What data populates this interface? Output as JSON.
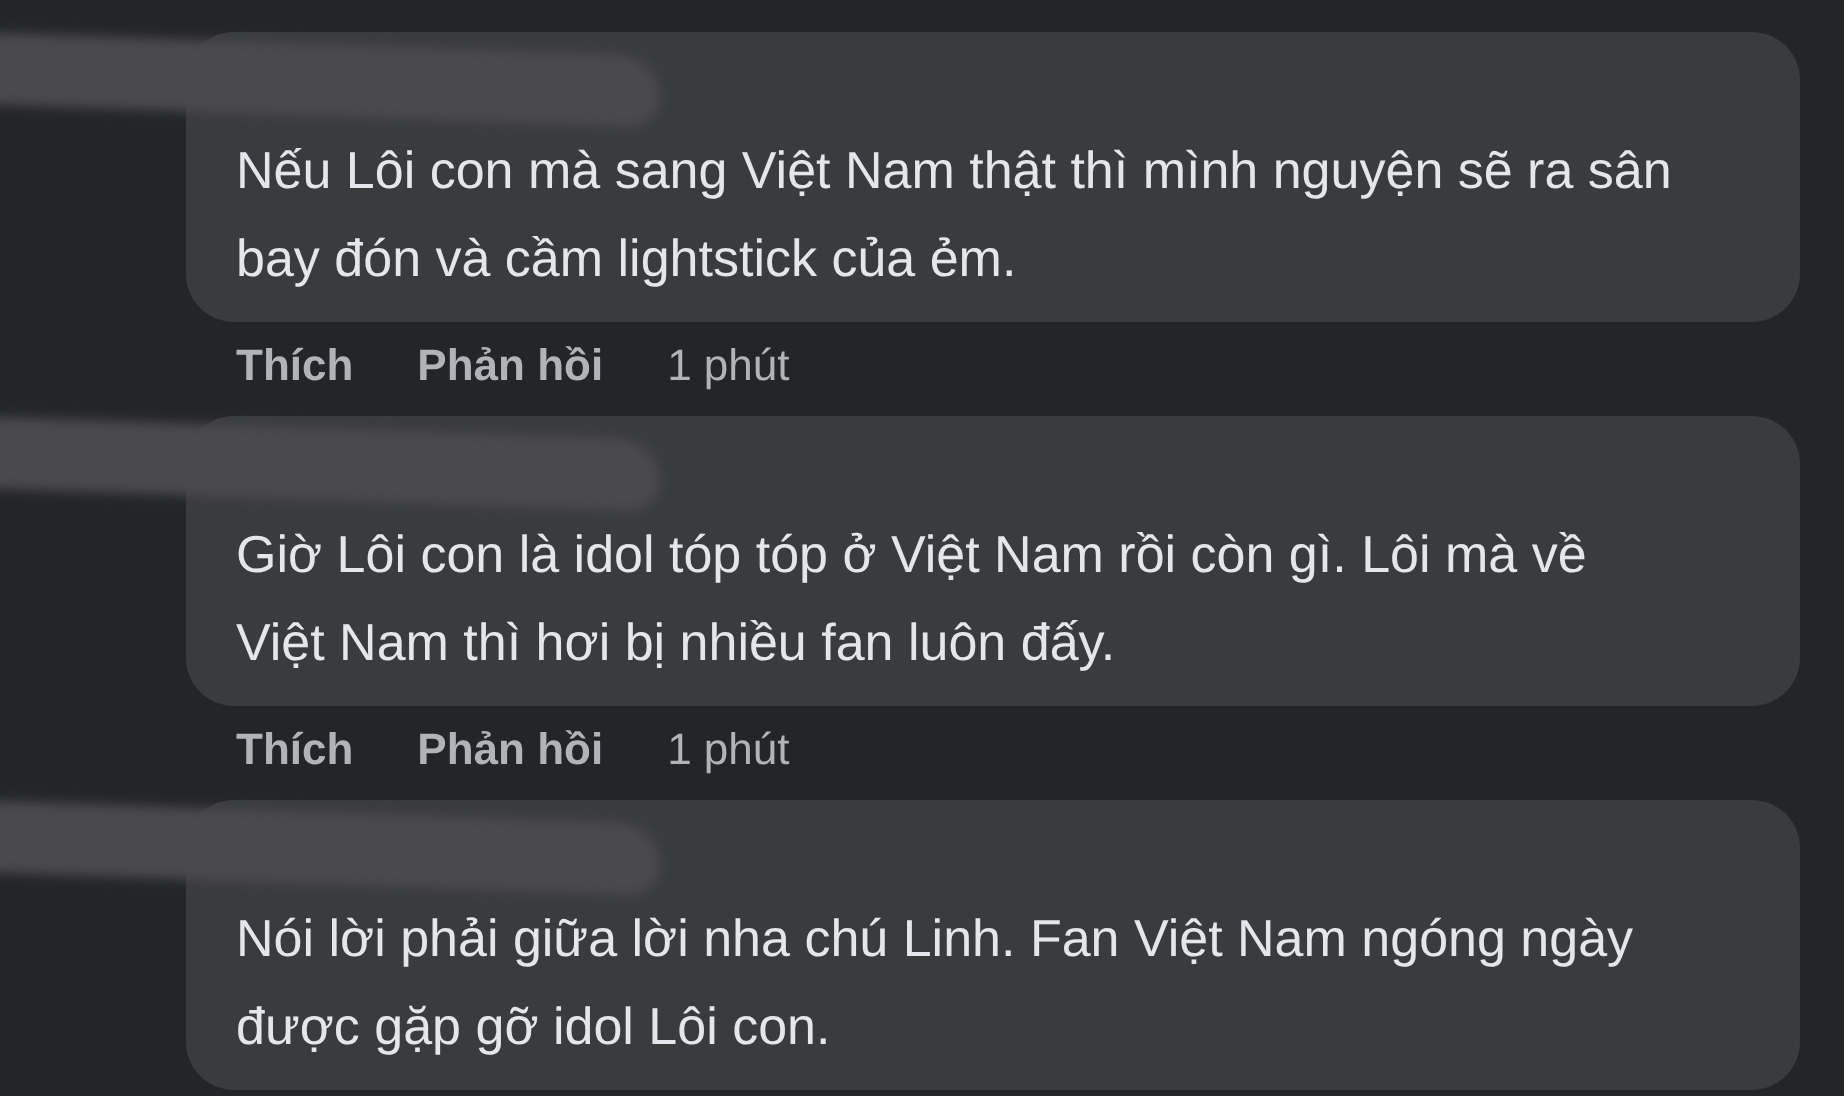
{
  "comments": [
    {
      "text": "Nếu Lôi con mà sang Việt Nam thật thì mình nguyện sẽ ra sân bay đón và cầm lightstick của ẻm.",
      "actions": [
        "Thích",
        "Phản hồi"
      ],
      "time": "1 phút"
    },
    {
      "text": "Giờ Lôi con là idol tóp tóp ở Việt Nam rồi còn gì. Lôi mà về Việt Nam thì hơi bị nhiều fan luôn đấy.",
      "actions": [
        "Thích",
        "Phản hồi"
      ],
      "time": "1 phút"
    },
    {
      "text": "Nói lời phải giữa lời nha chú Linh. Fan Việt Nam ngóng ngày được gặp gỡ idol Lôi con."
    }
  ]
}
